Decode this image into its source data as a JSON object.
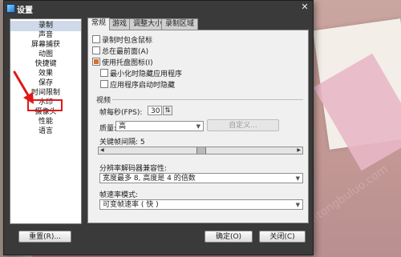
{
  "window": {
    "title": "设置"
  },
  "nav": {
    "items": [
      "录制",
      "声音",
      "屏幕捕获",
      "动图",
      "快捷键",
      "效果",
      "保存",
      "时间限制",
      "水印",
      "摄像头",
      "性能",
      "语言"
    ],
    "selected_index": 0,
    "highlighted_index": 9
  },
  "tabs": [
    "常规",
    "游戏",
    "调整大小",
    "录制区域"
  ],
  "general": {
    "record_mouse": "录制时包含鼠标",
    "always_on_top": "总在最前面(A)",
    "use_tray_icon": "使用托盘图标(I)",
    "minimize_hide": "最小化时隐藏应用程序",
    "hide_on_start": "应用程序启动时隐藏"
  },
  "video": {
    "group_label": "视频",
    "fps_label": "帧每秒(FPS):",
    "fps_value": "30",
    "quality_label": "质量:",
    "quality_value": "高",
    "custom_button": "自定义...",
    "keyframe_label": "关键帧间隔: 5",
    "keyframe_value": 0.5,
    "resolution_label": "分辨率解码器兼容性:",
    "resolution_value": "宽度最多 8, 高度是 4 的倍数",
    "framerate_label": "帧速率模式:",
    "framerate_value": "可变帧速率 ( 快 )"
  },
  "footer": {
    "reset": "重置(R)...",
    "ok": "确定(O)",
    "close": "关闭(C)"
  },
  "colors": {
    "highlight_box": "#e01818",
    "checkbox_checked": "#d8702a",
    "nav_selected": "#cfd9e9"
  },
  "icons": {
    "app": "app-icon",
    "close": "close-icon",
    "arrow": "red-arrow-annotation",
    "dropdown": "chevron-down-icon"
  }
}
